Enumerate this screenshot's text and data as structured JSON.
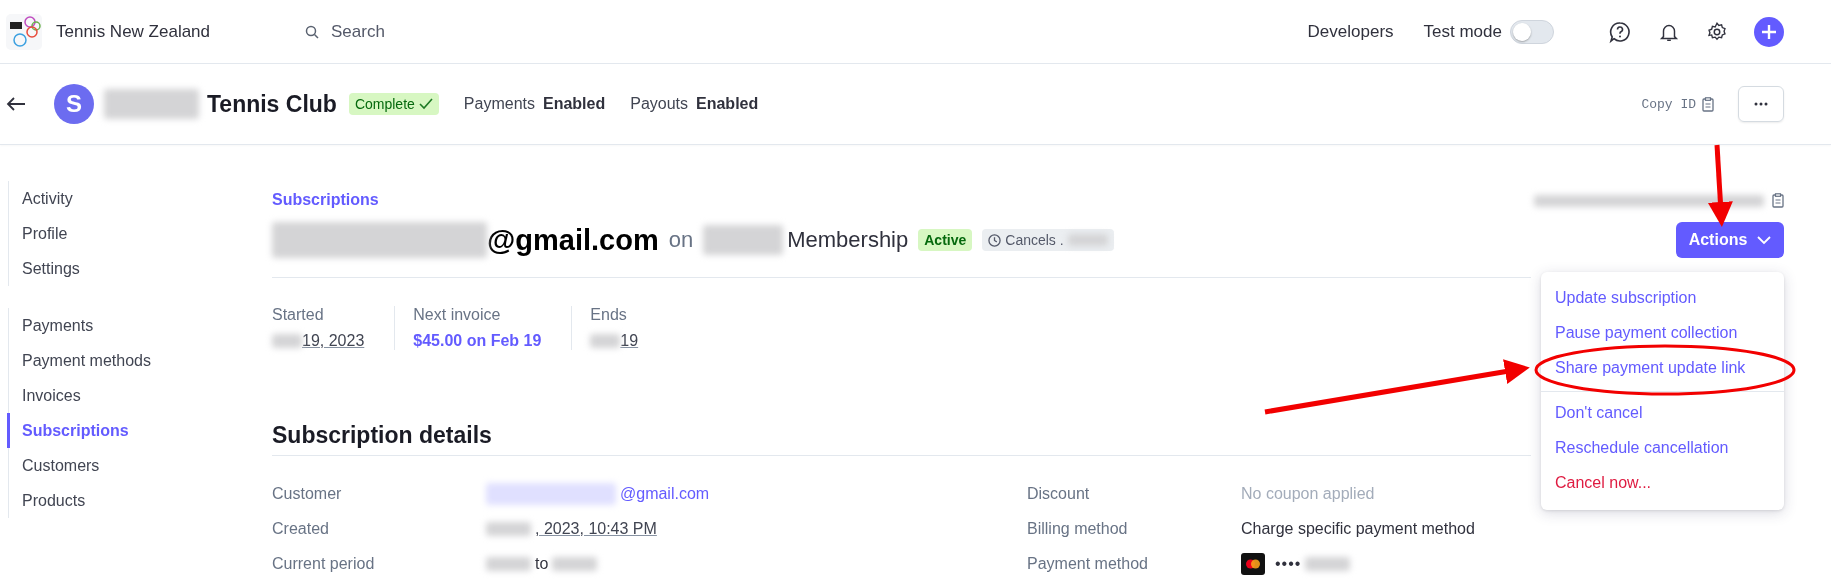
{
  "top_bar": {
    "org_name": "Tennis New Zealand",
    "search_placeholder": "Search",
    "developers": "Developers",
    "test_mode": {
      "label": "Test mode",
      "on": false
    }
  },
  "account_header": {
    "avatar_letter": "S",
    "name": "Tennis Club",
    "status": "Complete",
    "items": [
      {
        "label": "Payments",
        "value": "Enabled"
      },
      {
        "label": "Payouts",
        "value": "Enabled"
      }
    ],
    "copy_id": "Copy ID"
  },
  "sidebar": {
    "groups": [
      [
        {
          "label": "Activity",
          "selected": false
        },
        {
          "label": "Profile",
          "selected": false
        },
        {
          "label": "Settings",
          "selected": false
        }
      ],
      [
        {
          "label": "Payments",
          "selected": false
        },
        {
          "label": "Payment methods",
          "selected": false
        },
        {
          "label": "Invoices",
          "selected": false
        },
        {
          "label": "Subscriptions",
          "selected": true
        },
        {
          "label": "Customers",
          "selected": false
        },
        {
          "label": "Products",
          "selected": false
        }
      ]
    ]
  },
  "subscription": {
    "breadcrumb": "Subscriptions",
    "email": "@gmail.com",
    "on": "on",
    "product": "Membership",
    "status": "Active",
    "cancels": "Cancels .",
    "actions_label": "Actions",
    "stats": [
      {
        "label": "Started",
        "value": "19, 2023",
        "kind": "date"
      },
      {
        "label": "Next invoice",
        "value": "$45.00 on Feb 19",
        "kind": "link"
      },
      {
        "label": "Ends",
        "value": "19",
        "kind": "date"
      }
    ]
  },
  "details": {
    "title": "Subscription details",
    "left": [
      {
        "label": "Customer",
        "value": "@gmail.com",
        "kind": "link"
      },
      {
        "label": "Created",
        "value": ", 2023, 10:43 PM",
        "kind": "date"
      },
      {
        "label": "Current period",
        "value": "to",
        "kind": "period"
      }
    ],
    "right": [
      {
        "label": "Discount",
        "value": "No coupon applied",
        "kind": "muted"
      },
      {
        "label": "Billing method",
        "value": "Charge specific payment method",
        "kind": "plain"
      },
      {
        "label": "Payment method",
        "value": "••••",
        "kind": "card"
      }
    ]
  },
  "actions_menu": {
    "groups": [
      [
        {
          "label": "Update subscription",
          "kind": "normal"
        },
        {
          "label": "Pause payment collection",
          "kind": "normal"
        },
        {
          "label": "Share payment update link",
          "kind": "normal"
        }
      ],
      [
        {
          "label": "Don't cancel",
          "kind": "normal"
        },
        {
          "label": "Reschedule cancellation",
          "kind": "normal"
        },
        {
          "label": "Cancel now...",
          "kind": "danger"
        }
      ]
    ]
  }
}
